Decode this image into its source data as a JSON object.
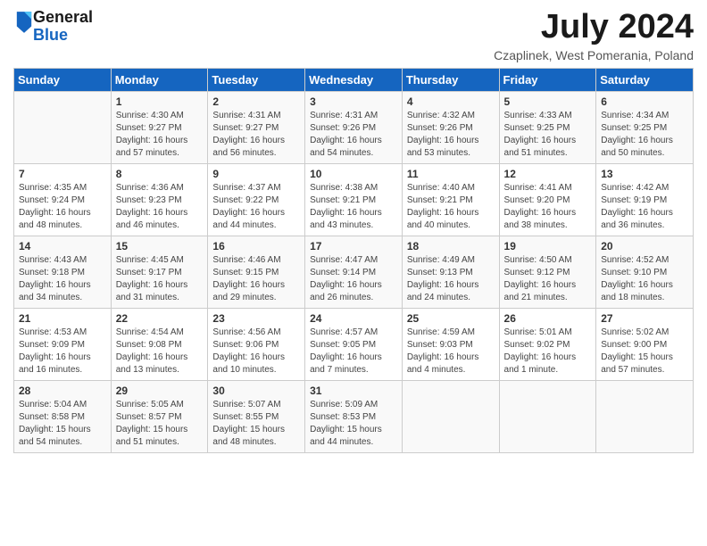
{
  "header": {
    "logo_general": "General",
    "logo_blue": "Blue",
    "month_title": "July 2024",
    "location": "Czaplinek, West Pomerania, Poland"
  },
  "days_of_week": [
    "Sunday",
    "Monday",
    "Tuesday",
    "Wednesday",
    "Thursday",
    "Friday",
    "Saturday"
  ],
  "weeks": [
    [
      {
        "day": "",
        "content": ""
      },
      {
        "day": "1",
        "content": "Sunrise: 4:30 AM\nSunset: 9:27 PM\nDaylight: 16 hours and 57 minutes."
      },
      {
        "day": "2",
        "content": "Sunrise: 4:31 AM\nSunset: 9:27 PM\nDaylight: 16 hours and 56 minutes."
      },
      {
        "day": "3",
        "content": "Sunrise: 4:31 AM\nSunset: 9:26 PM\nDaylight: 16 hours and 54 minutes."
      },
      {
        "day": "4",
        "content": "Sunrise: 4:32 AM\nSunset: 9:26 PM\nDaylight: 16 hours and 53 minutes."
      },
      {
        "day": "5",
        "content": "Sunrise: 4:33 AM\nSunset: 9:25 PM\nDaylight: 16 hours and 51 minutes."
      },
      {
        "day": "6",
        "content": "Sunrise: 4:34 AM\nSunset: 9:25 PM\nDaylight: 16 hours and 50 minutes."
      }
    ],
    [
      {
        "day": "7",
        "content": "Sunrise: 4:35 AM\nSunset: 9:24 PM\nDaylight: 16 hours and 48 minutes."
      },
      {
        "day": "8",
        "content": "Sunrise: 4:36 AM\nSunset: 9:23 PM\nDaylight: 16 hours and 46 minutes."
      },
      {
        "day": "9",
        "content": "Sunrise: 4:37 AM\nSunset: 9:22 PM\nDaylight: 16 hours and 44 minutes."
      },
      {
        "day": "10",
        "content": "Sunrise: 4:38 AM\nSunset: 9:21 PM\nDaylight: 16 hours and 43 minutes."
      },
      {
        "day": "11",
        "content": "Sunrise: 4:40 AM\nSunset: 9:21 PM\nDaylight: 16 hours and 40 minutes."
      },
      {
        "day": "12",
        "content": "Sunrise: 4:41 AM\nSunset: 9:20 PM\nDaylight: 16 hours and 38 minutes."
      },
      {
        "day": "13",
        "content": "Sunrise: 4:42 AM\nSunset: 9:19 PM\nDaylight: 16 hours and 36 minutes."
      }
    ],
    [
      {
        "day": "14",
        "content": "Sunrise: 4:43 AM\nSunset: 9:18 PM\nDaylight: 16 hours and 34 minutes."
      },
      {
        "day": "15",
        "content": "Sunrise: 4:45 AM\nSunset: 9:17 PM\nDaylight: 16 hours and 31 minutes."
      },
      {
        "day": "16",
        "content": "Sunrise: 4:46 AM\nSunset: 9:15 PM\nDaylight: 16 hours and 29 minutes."
      },
      {
        "day": "17",
        "content": "Sunrise: 4:47 AM\nSunset: 9:14 PM\nDaylight: 16 hours and 26 minutes."
      },
      {
        "day": "18",
        "content": "Sunrise: 4:49 AM\nSunset: 9:13 PM\nDaylight: 16 hours and 24 minutes."
      },
      {
        "day": "19",
        "content": "Sunrise: 4:50 AM\nSunset: 9:12 PM\nDaylight: 16 hours and 21 minutes."
      },
      {
        "day": "20",
        "content": "Sunrise: 4:52 AM\nSunset: 9:10 PM\nDaylight: 16 hours and 18 minutes."
      }
    ],
    [
      {
        "day": "21",
        "content": "Sunrise: 4:53 AM\nSunset: 9:09 PM\nDaylight: 16 hours and 16 minutes."
      },
      {
        "day": "22",
        "content": "Sunrise: 4:54 AM\nSunset: 9:08 PM\nDaylight: 16 hours and 13 minutes."
      },
      {
        "day": "23",
        "content": "Sunrise: 4:56 AM\nSunset: 9:06 PM\nDaylight: 16 hours and 10 minutes."
      },
      {
        "day": "24",
        "content": "Sunrise: 4:57 AM\nSunset: 9:05 PM\nDaylight: 16 hours and 7 minutes."
      },
      {
        "day": "25",
        "content": "Sunrise: 4:59 AM\nSunset: 9:03 PM\nDaylight: 16 hours and 4 minutes."
      },
      {
        "day": "26",
        "content": "Sunrise: 5:01 AM\nSunset: 9:02 PM\nDaylight: 16 hours and 1 minute."
      },
      {
        "day": "27",
        "content": "Sunrise: 5:02 AM\nSunset: 9:00 PM\nDaylight: 15 hours and 57 minutes."
      }
    ],
    [
      {
        "day": "28",
        "content": "Sunrise: 5:04 AM\nSunset: 8:58 PM\nDaylight: 15 hours and 54 minutes."
      },
      {
        "day": "29",
        "content": "Sunrise: 5:05 AM\nSunset: 8:57 PM\nDaylight: 15 hours and 51 minutes."
      },
      {
        "day": "30",
        "content": "Sunrise: 5:07 AM\nSunset: 8:55 PM\nDaylight: 15 hours and 48 minutes."
      },
      {
        "day": "31",
        "content": "Sunrise: 5:09 AM\nSunset: 8:53 PM\nDaylight: 15 hours and 44 minutes."
      },
      {
        "day": "",
        "content": ""
      },
      {
        "day": "",
        "content": ""
      },
      {
        "day": "",
        "content": ""
      }
    ]
  ]
}
